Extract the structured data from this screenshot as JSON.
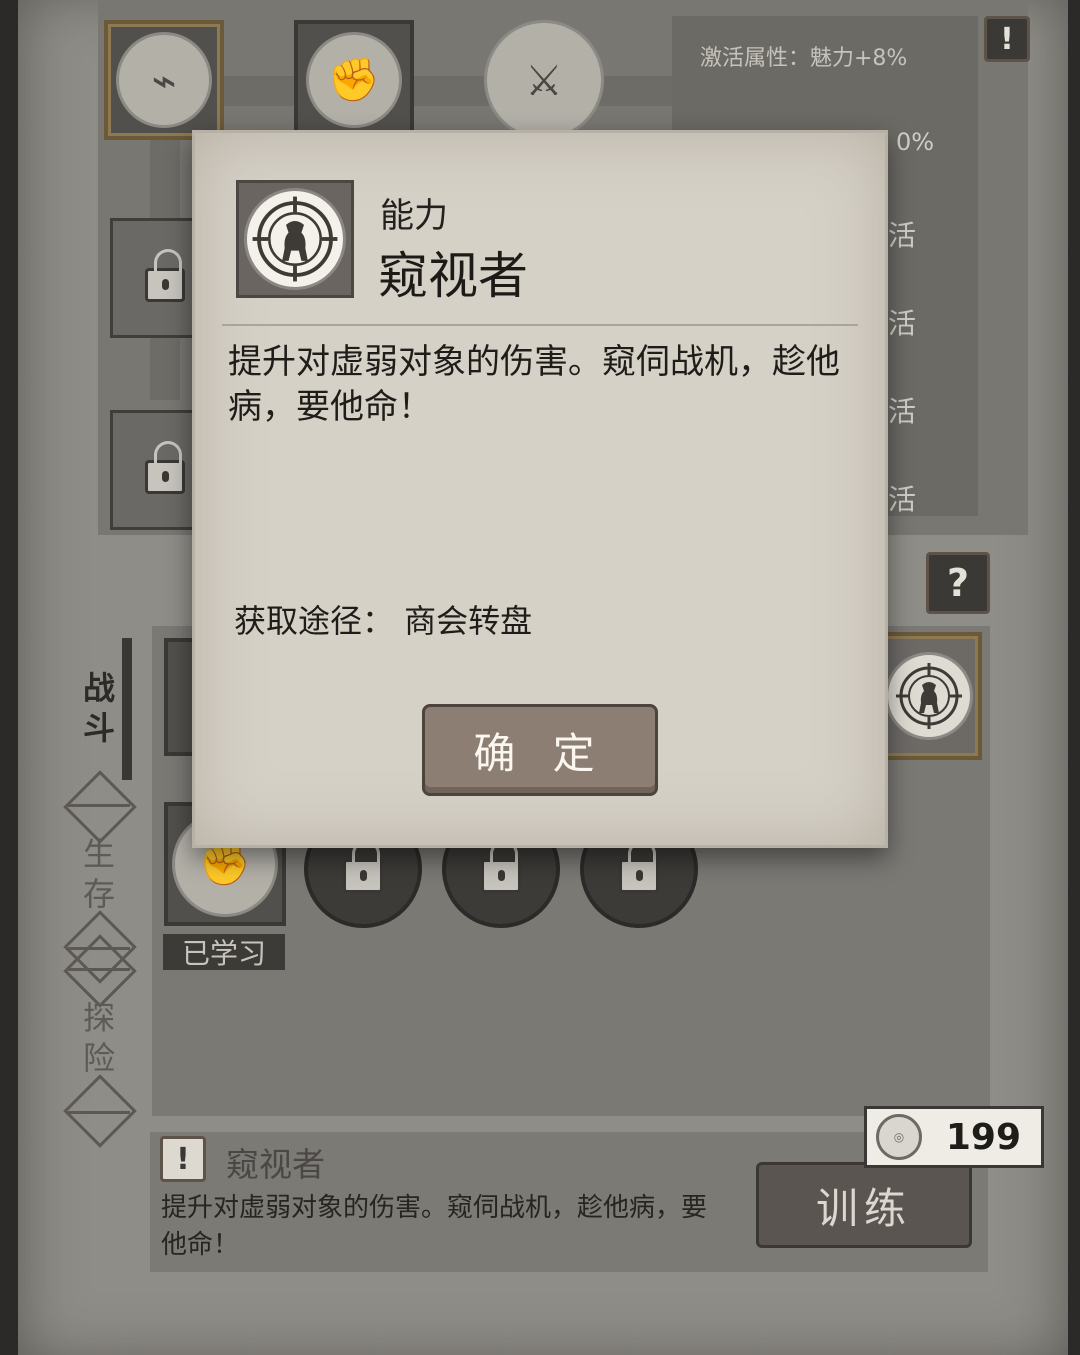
{
  "top": {
    "attr_line": "激活属性：魅力+8%",
    "attr_partial": "0%",
    "activate_partials": [
      "活",
      "活",
      "活",
      "活"
    ],
    "help_badge": "!"
  },
  "tabs": {
    "combat": "战斗",
    "survival": "生存",
    "explore": "探险"
  },
  "question_badge": "?",
  "learned_tag": "已学习",
  "info": {
    "badge": "!",
    "title": "窥视者",
    "description": "提升对虚弱对象的伤害。窥伺战机，趁他病，要他命！"
  },
  "train_button": "训练",
  "cost": "199",
  "dialog": {
    "category": "能力",
    "name": "窥视者",
    "description": "提升对虚弱对象的伤害。窥伺战机，趁他病，要他命！",
    "source": "获取途径：  商会转盘",
    "ok_label": "确 定"
  },
  "icons": {
    "dialog_icon": "bear-crosshair-icon",
    "top_skills": [
      "stomach-icon",
      "fist-wrap-icon",
      "boxer-icon"
    ]
  }
}
